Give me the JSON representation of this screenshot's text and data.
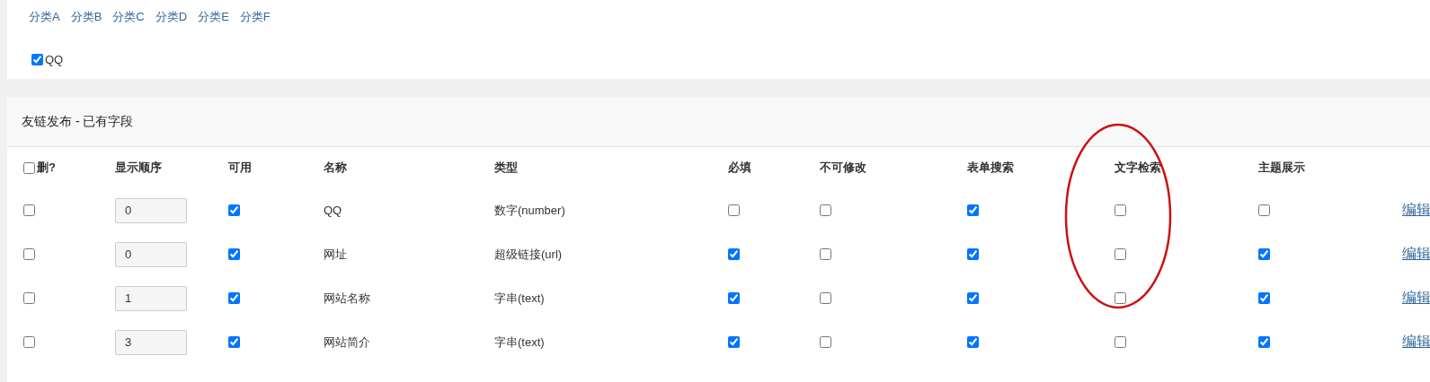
{
  "categories": [
    {
      "label": "分类A"
    },
    {
      "label": "分类B"
    },
    {
      "label": "分类C"
    },
    {
      "label": "分类D"
    },
    {
      "label": "分类E"
    },
    {
      "label": "分类F"
    }
  ],
  "field_options": [
    {
      "label": "QQ",
      "checked": true
    }
  ],
  "panel": {
    "title": "友链发布 - 已有字段"
  },
  "table": {
    "select_all": {
      "label": "删?",
      "checked": false
    },
    "columns": [
      "显示顺序",
      "可用",
      "名称",
      "类型",
      "必填",
      "不可修改",
      "表单搜索",
      "文字检索",
      "主题展示"
    ],
    "rows": [
      {
        "delete": false,
        "order": "0",
        "available": true,
        "name": "QQ",
        "type": "数字(number)",
        "required": false,
        "readonly": false,
        "form_search": true,
        "text_search": false,
        "thread_show": false,
        "action": "编辑"
      },
      {
        "delete": false,
        "order": "0",
        "available": true,
        "name": "网址",
        "type": "超级链接(url)",
        "required": true,
        "readonly": false,
        "form_search": true,
        "text_search": false,
        "thread_show": true,
        "action": "编辑"
      },
      {
        "delete": false,
        "order": "1",
        "available": true,
        "name": "网站名称",
        "type": "字串(text)",
        "required": true,
        "readonly": false,
        "form_search": true,
        "text_search": false,
        "thread_show": true,
        "action": "编辑"
      },
      {
        "delete": false,
        "order": "3",
        "available": true,
        "name": "网站简介",
        "type": "字串(text)",
        "required": true,
        "readonly": false,
        "form_search": true,
        "text_search": false,
        "thread_show": true,
        "action": "编辑"
      }
    ]
  },
  "annotation": {
    "kind": "ellipse"
  }
}
